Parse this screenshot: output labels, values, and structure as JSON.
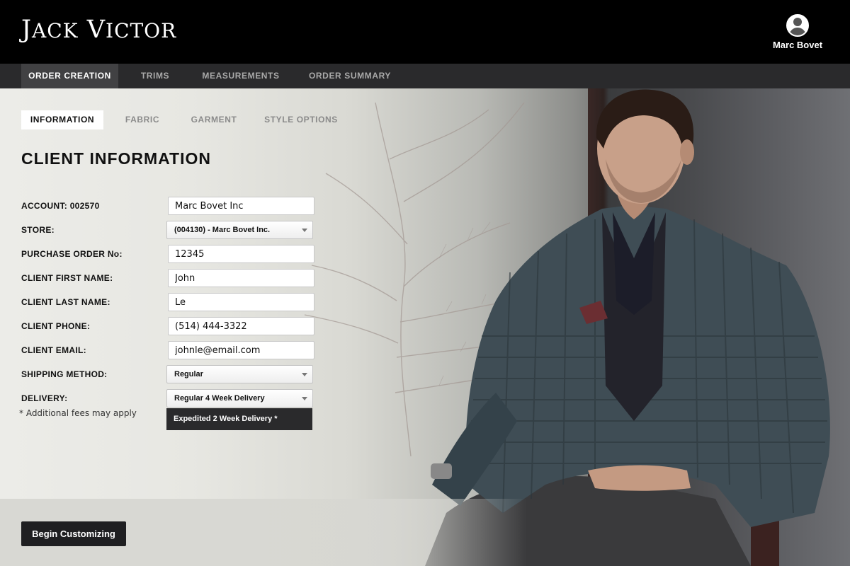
{
  "brand": {
    "logo_first_initial": "J",
    "logo_first_rest": "ACK",
    "logo_second_initial": "V",
    "logo_second_rest": "ICTOR"
  },
  "user": {
    "name": "Marc Bovet",
    "icon": "user-avatar-icon"
  },
  "main_nav": [
    {
      "label": "ORDER CREATION",
      "active": true
    },
    {
      "label": "TRIMS",
      "active": false
    },
    {
      "label": "MEASUREMENTS",
      "active": false
    },
    {
      "label": "ORDER SUMMARY",
      "active": false
    }
  ],
  "sub_tabs": [
    {
      "label": "INFORMATION",
      "active": true
    },
    {
      "label": "FABRIC",
      "active": false
    },
    {
      "label": "GARMENT",
      "active": false
    },
    {
      "label": "STYLE OPTIONS",
      "active": false
    }
  ],
  "section_title": "CLIENT INFORMATION",
  "form": {
    "account": {
      "label": "ACCOUNT: 002570",
      "value": "Marc Bovet Inc"
    },
    "store": {
      "label": "STORE:",
      "value": "(004130) - Marc Bovet Inc."
    },
    "purchase_order": {
      "label": "PURCHASE ORDER No:",
      "value": "12345"
    },
    "first_name": {
      "label": "CLIENT FIRST NAME:",
      "value": "John"
    },
    "last_name": {
      "label": "CLIENT LAST NAME:",
      "value": "Le"
    },
    "phone": {
      "label": "CLIENT PHONE:",
      "value": "(514) 444-3322"
    },
    "email": {
      "label": "CLIENT EMAIL:",
      "value": "johnle@email.com"
    },
    "shipping": {
      "label": "SHIPPING METHOD:",
      "value": "Regular"
    },
    "delivery": {
      "label": "DELIVERY:",
      "value": "Regular 4 Week Delivery",
      "open_option": "Expedited 2 Week Delivery *"
    },
    "note": "* Additional fees may apply"
  },
  "actions": {
    "begin_label": "Begin Customizing"
  },
  "colors": {
    "topbar": "#000000",
    "nav": "#2a2a2c",
    "nav_active": "#414143",
    "button": "#1f1f21"
  }
}
